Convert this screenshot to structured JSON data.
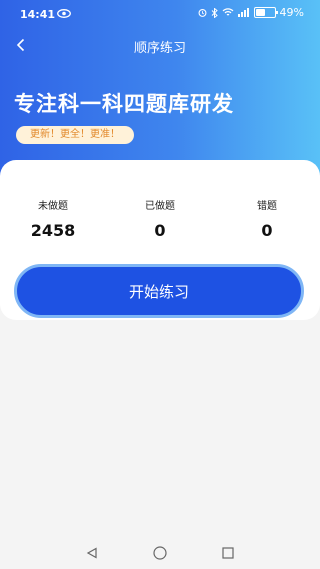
{
  "status": {
    "time": "14:41",
    "battery": "49%",
    "battery_level": 0.49
  },
  "nav": {
    "title": "顺序练习"
  },
  "hero": {
    "headline": "专注科一科四题库研发",
    "tagline": "更新！更全！更准！"
  },
  "stats": [
    {
      "label": "未做题",
      "value": "2458"
    },
    {
      "label": "已做题",
      "value": "0"
    },
    {
      "label": "错题",
      "value": "0"
    }
  ],
  "actions": {
    "start_label": "开始练习"
  },
  "colors": {
    "accent": "#1e52e3",
    "gradient_start": "#2f63e6",
    "gradient_end": "#59c1f7",
    "tagline_text": "#e2892b"
  }
}
